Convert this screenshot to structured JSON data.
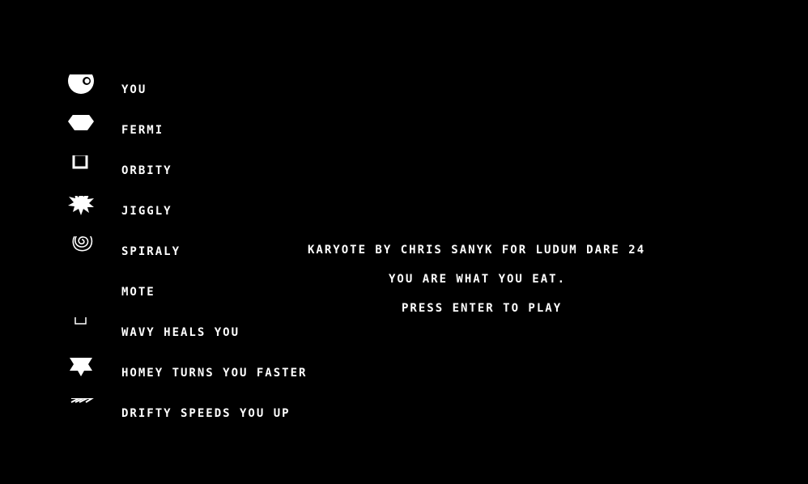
{
  "legend": [
    {
      "icon": "player-circle-icon",
      "label": "YOU"
    },
    {
      "icon": "hexagon-icon",
      "label": "FERMI"
    },
    {
      "icon": "square-outline-icon",
      "label": "ORBITY"
    },
    {
      "icon": "spiky-blob-icon",
      "label": "JIGGLY"
    },
    {
      "icon": "spiral-icon",
      "label": "SPIRALY"
    },
    {
      "icon": "dot-icon",
      "label": "MOTE"
    },
    {
      "icon": "small-square-icon",
      "label": "WAVY HEALS YOU"
    },
    {
      "icon": "star-icon",
      "label": "HOMEY TURNS YOU FASTER"
    },
    {
      "icon": "chevron-arrow-icon",
      "label": "DRIFTY SPEEDS YOU UP"
    }
  ],
  "title": {
    "credits": "KARYOTE BY CHRIS SANYK FOR LUDUM DARE 24",
    "tagline": "YOU ARE WHAT YOU EAT.",
    "prompt": "PRESS ENTER TO PLAY"
  },
  "colors": {
    "background": "#000000",
    "foreground": "#ffffff"
  }
}
